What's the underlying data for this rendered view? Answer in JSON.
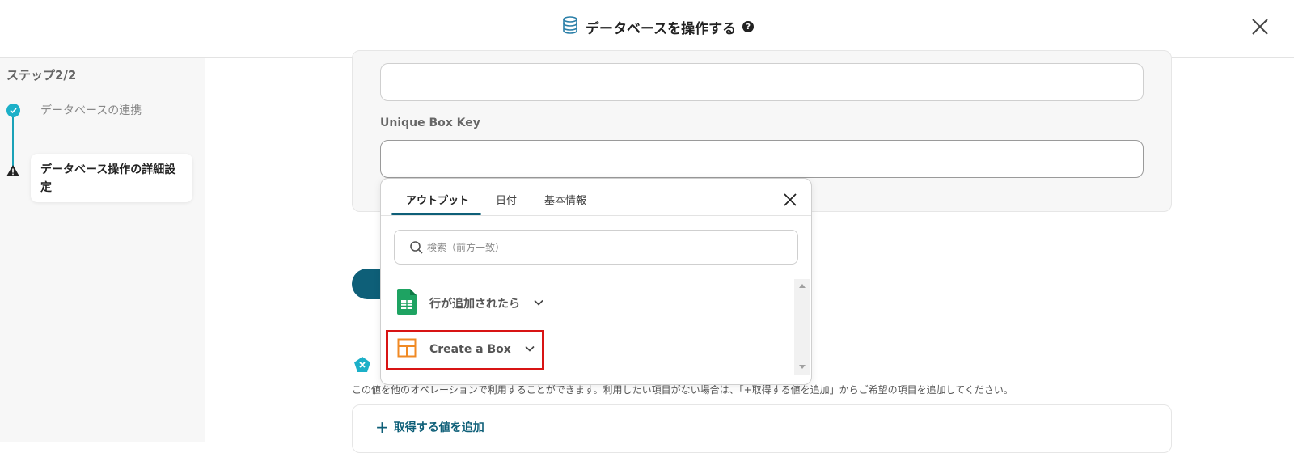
{
  "header": {
    "title": "データベースを操作する",
    "help_symbol": "?"
  },
  "sidebar": {
    "step_label": "ステップ2/2",
    "steps": [
      {
        "label": "データベースの連携",
        "status": "done"
      },
      {
        "label": "データベース操作の詳細設定",
        "status": "warning"
      }
    ]
  },
  "form": {
    "unique_box_key_label": "Unique Box Key"
  },
  "popup": {
    "tabs": [
      "アウトプット",
      "日付",
      "基本情報"
    ],
    "active_tab": "アウトプット",
    "search_placeholder": "検索（前方一致）",
    "items": [
      {
        "label": "行が追加されたら",
        "icon": "google-sheets-icon"
      },
      {
        "label": "Create a Box",
        "icon": "box-layout-icon"
      }
    ]
  },
  "outputs": {
    "description": "この値を他のオペレーションで利用することができます。利用したい項目がない場合は、「+取得する値を追加」からご希望の項目を追加してください。",
    "add_label": "取得する値を追加"
  },
  "colors": {
    "accent": "#0e5f78",
    "step_done": "#1cb0c8",
    "highlight": "#d81414",
    "sheets_green": "#1ea362",
    "box_orange": "#f08a24"
  }
}
